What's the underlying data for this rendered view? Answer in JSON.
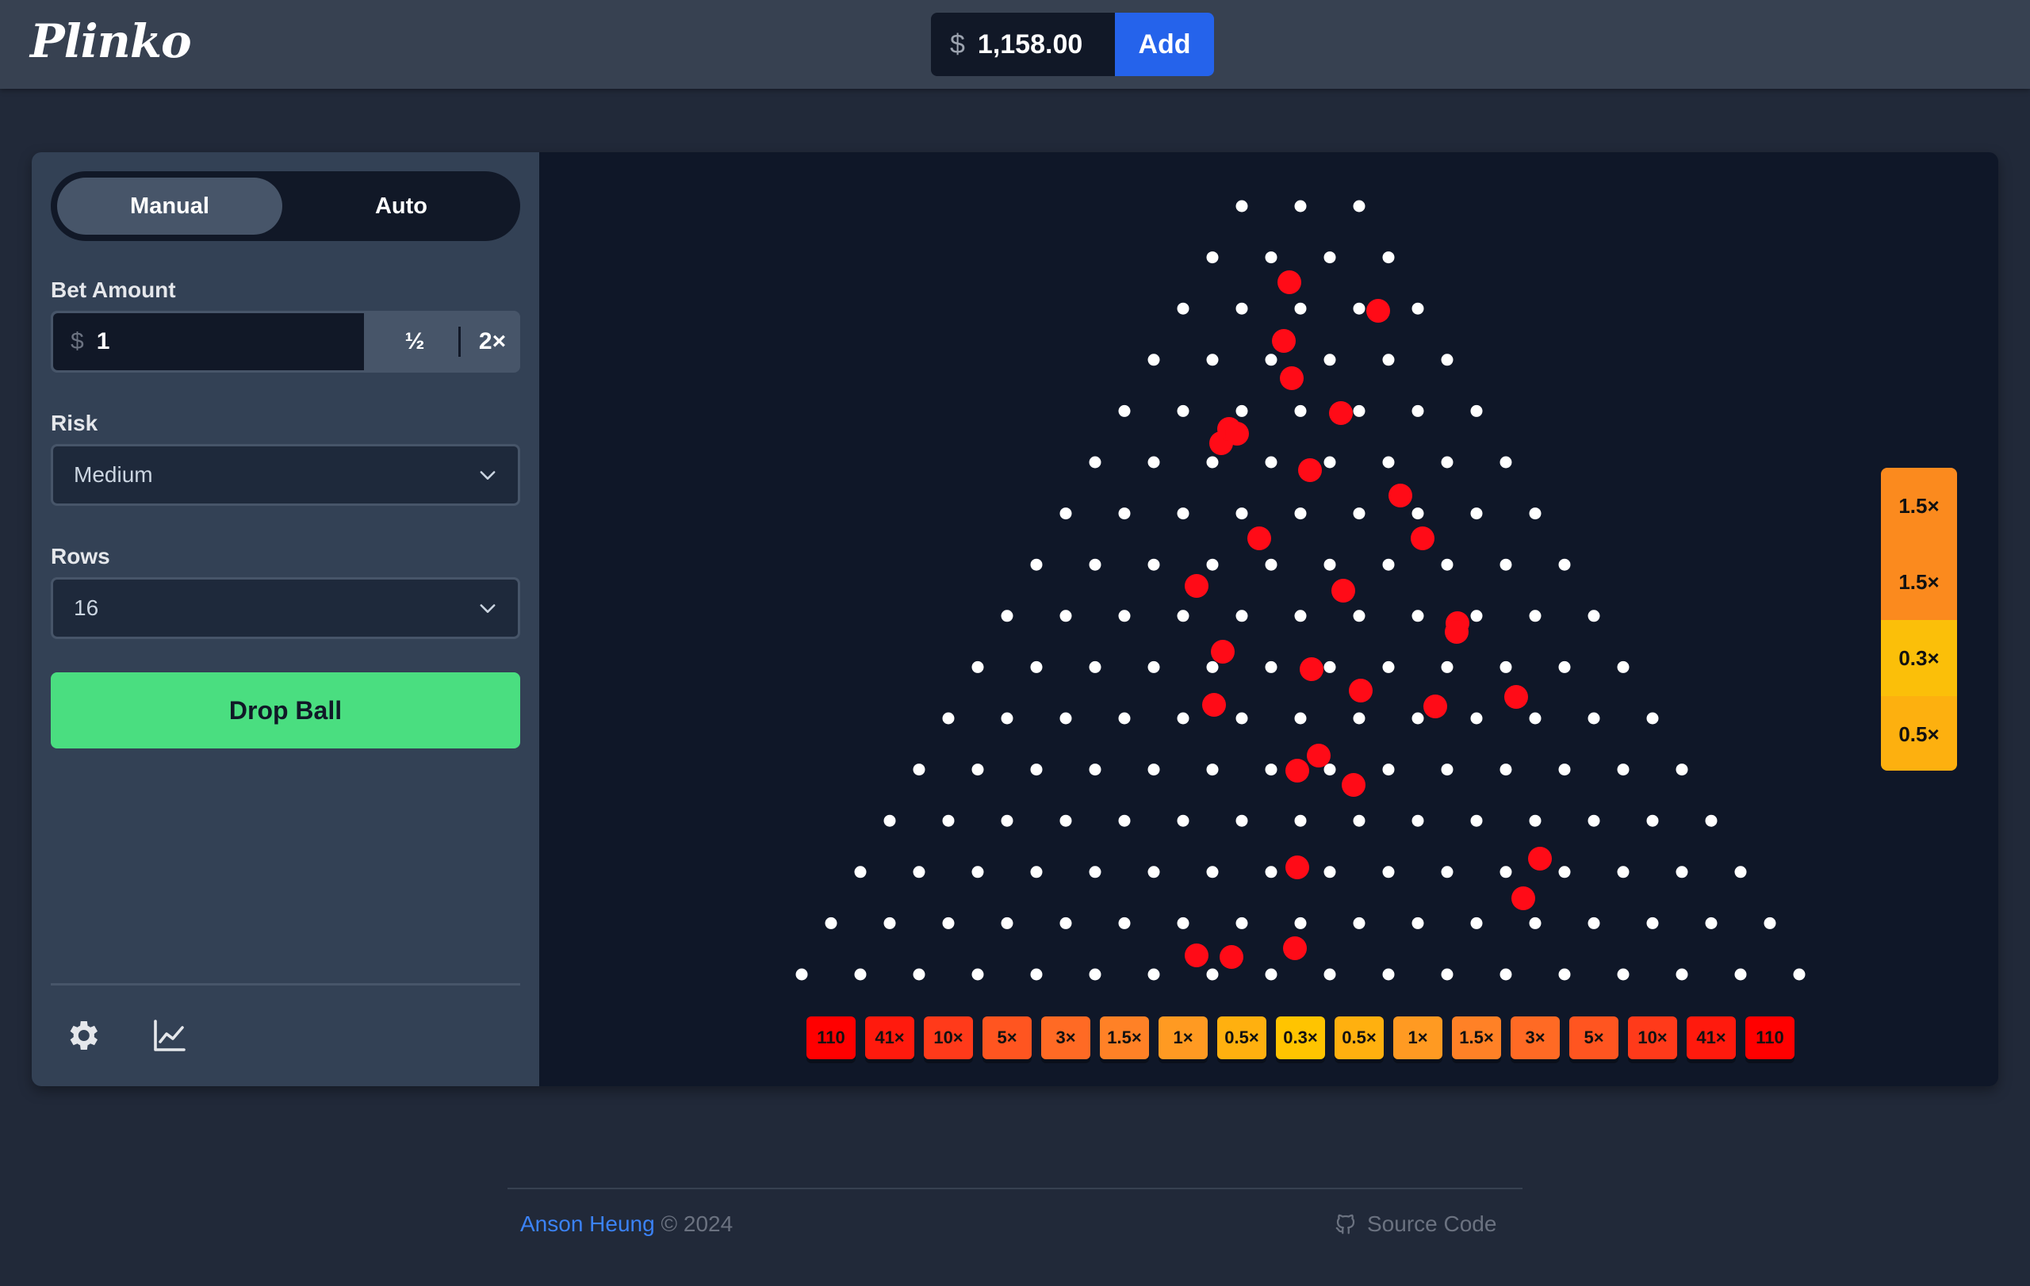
{
  "header": {
    "logo": "Plinko",
    "balance_currency": "$",
    "balance": "1,158.00",
    "add_label": "Add"
  },
  "sidebar": {
    "mode_manual": "Manual",
    "mode_auto": "Auto",
    "active_mode": "Manual",
    "bet_label": "Bet Amount",
    "bet_currency": "$",
    "bet_value": "1",
    "half_label": "½",
    "double_label": "2×",
    "risk_label": "Risk",
    "risk_value": "Medium",
    "rows_label": "Rows",
    "rows_value": "16",
    "drop_label": "Drop Ball",
    "icons": [
      "settings-icon",
      "chart-icon"
    ]
  },
  "board": {
    "rows": 16,
    "multipliers": [
      "110",
      "41×",
      "10×",
      "5×",
      "3×",
      "1.5×",
      "1×",
      "0.5×",
      "0.3×",
      "0.5×",
      "1×",
      "1.5×",
      "3×",
      "5×",
      "10×",
      "41×",
      "110"
    ],
    "slot_colors": [
      "#ff0000",
      "#ff1a0d",
      "#ff3a1a",
      "#ff5520",
      "#ff6a24",
      "#ff8126",
      "#ff9a22",
      "#ffb00f",
      "#ffc400",
      "#ffb00f",
      "#ff9a22",
      "#ff8126",
      "#ff6a24",
      "#ff5520",
      "#ff3a1a",
      "#ff1a0d",
      "#ff0000"
    ],
    "peg_color": "#ffffff",
    "ball_color": "#ff0b17"
  },
  "history": [
    {
      "label": "1.5×",
      "color": "#fb8a1e"
    },
    {
      "label": "1.5×",
      "color": "#fb8a1e"
    },
    {
      "label": "0.3×",
      "color": "#fbbf09"
    },
    {
      "label": "0.5×",
      "color": "#fdb00f"
    }
  ],
  "footer": {
    "author": "Anson Heung",
    "copyright": "© 2024",
    "source_label": "Source Code"
  }
}
